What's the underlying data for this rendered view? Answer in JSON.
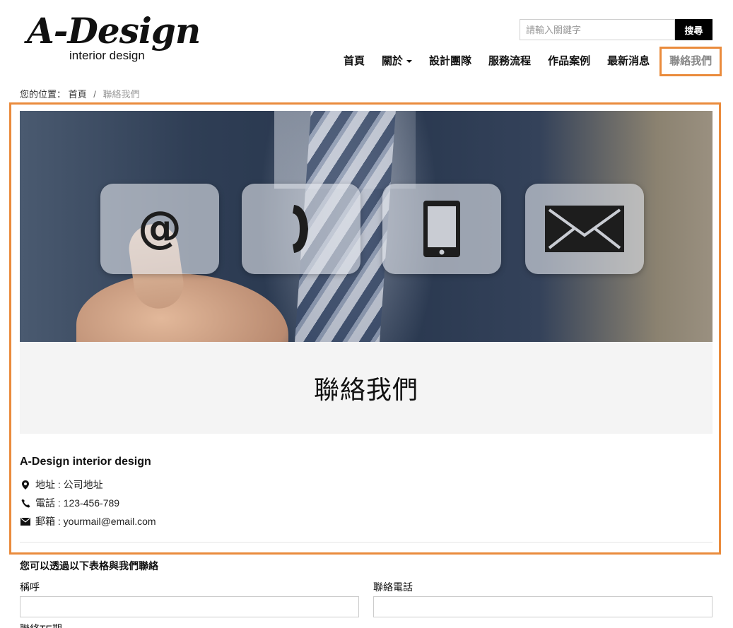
{
  "logo": {
    "main": "A-Design",
    "sub": "interior design"
  },
  "search": {
    "placeholder": "請輸入關鍵字",
    "button_label": "搜尋"
  },
  "nav": {
    "items": [
      {
        "label": "首頁"
      },
      {
        "label": "關於"
      },
      {
        "label": "設計團隊"
      },
      {
        "label": "服務流程"
      },
      {
        "label": "作品案例"
      },
      {
        "label": "最新消息"
      },
      {
        "label": "聯絡我們"
      }
    ],
    "active": "聯絡我們"
  },
  "breadcrumb": {
    "prefix": "您的位置：",
    "home": "首頁",
    "separator": "/",
    "current": "聯絡我們"
  },
  "banner": {
    "icons": [
      "at-sign-icon",
      "phone-handset-icon",
      "smartphone-icon",
      "envelope-icon"
    ]
  },
  "page_title": "聯絡我們",
  "contact": {
    "company": "A-Design interior design",
    "address": "地址 : 公司地址",
    "phone": "電話 : 123-456-789",
    "email": "郵箱 : yourmail@email.com"
  },
  "form": {
    "intro": "您可以透過以下表格與我們聯絡",
    "fields": [
      {
        "label": "稱呼",
        "value": ""
      },
      {
        "label": "聯絡電話",
        "value": ""
      }
    ],
    "next_label_partial": "聯絡TE期"
  },
  "colors": {
    "highlight": "#ea8b3c",
    "button_bg": "#000000",
    "band_bg": "#f4f4f4"
  }
}
